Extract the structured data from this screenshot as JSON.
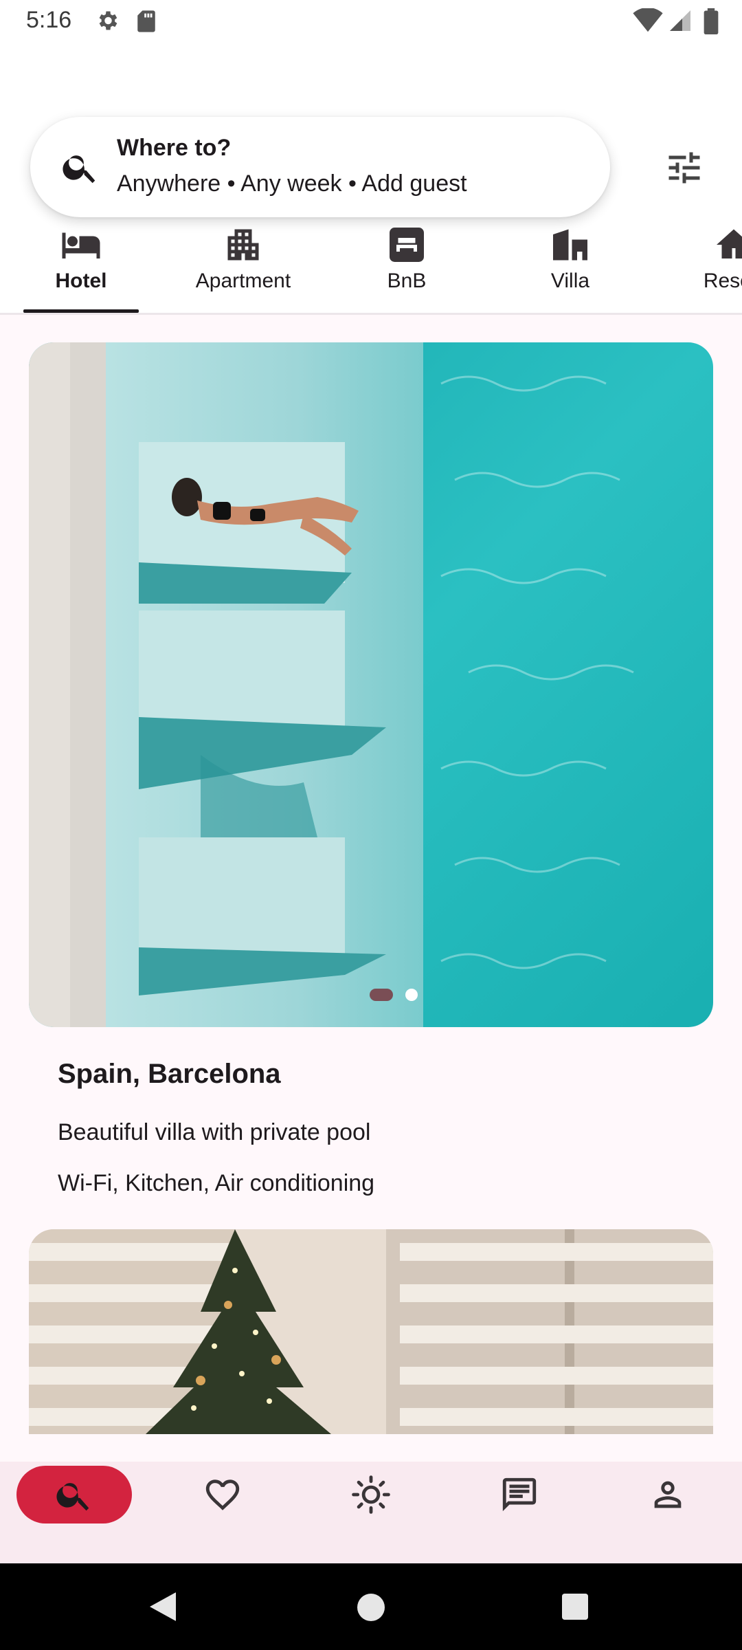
{
  "status_bar": {
    "time": "5:16",
    "icons": [
      "gear-icon",
      "sd-card-icon",
      "wifi-icon",
      "cell-signal-icon",
      "battery-icon"
    ]
  },
  "search": {
    "title": "Where to?",
    "subtitle": "Anywhere • Any week • Add guest",
    "icon": "search-icon"
  },
  "filter_icon": "tune-icon",
  "categories": [
    {
      "label": "Hotel",
      "icon": "bed-icon",
      "active": true
    },
    {
      "label": "Apartment",
      "icon": "apartment-icon",
      "active": false
    },
    {
      "label": "BnB",
      "icon": "bnb-icon",
      "active": false
    },
    {
      "label": "Villa",
      "icon": "villa-icon",
      "active": false
    },
    {
      "label": "Resort",
      "icon": "house-icon",
      "active": false
    }
  ],
  "listing": {
    "title": "Spain, Barcelona",
    "description": "Beautiful villa with private pool",
    "amenities": "Wi-Fi, Kitchen, Air conditioning",
    "image": "pool-photo",
    "pager": {
      "count": 2,
      "active_index": 0
    }
  },
  "next_listing": {
    "image": "christmas-tree-photo"
  },
  "bottom_nav": [
    {
      "icon": "search-icon",
      "active": true
    },
    {
      "icon": "heart-icon",
      "active": false
    },
    {
      "icon": "sun-icon",
      "active": false
    },
    {
      "icon": "chat-icon",
      "active": false
    },
    {
      "icon": "person-icon",
      "active": false
    }
  ],
  "system_nav": [
    "back-icon",
    "home-icon",
    "recents-icon"
  ],
  "colors": {
    "background": "#FFF8FB",
    "accent": "#D3233F",
    "bottom_nav_bg": "#F9EAF0",
    "text": "#1E1A1D"
  }
}
